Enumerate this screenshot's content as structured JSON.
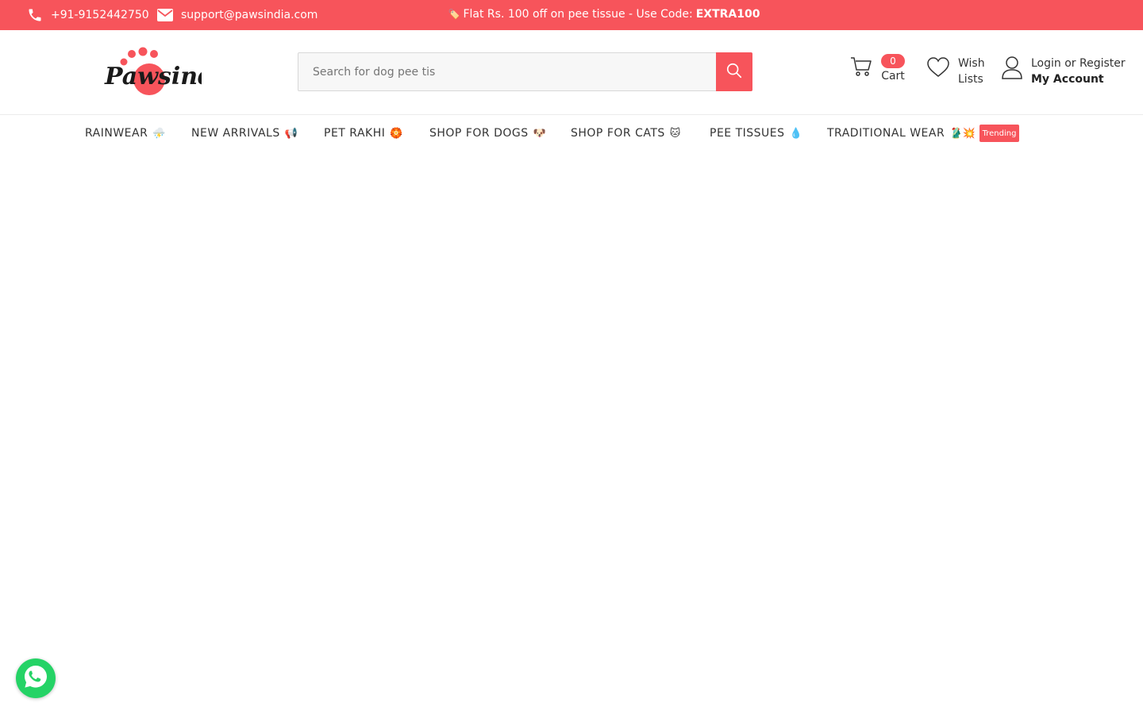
{
  "topbar": {
    "phone": "+91-9152442750",
    "email": "support@pawsindia.com",
    "promo_icon": "🏷️",
    "promo_text": "Flat Rs. 100 off on pee tissue - Use Code:",
    "promo_code": "EXTRA100",
    "bg_color": "#f7545b"
  },
  "header": {
    "logo_text": "Pawsindia",
    "search": {
      "value": "Search for dog pee tis",
      "placeholder": "Search for dog pee tis"
    },
    "cart": {
      "count": "0",
      "label": "Cart"
    },
    "wishlist": {
      "line1": "Wish",
      "line2": "Lists"
    },
    "account": {
      "login": "Login",
      "or": "or",
      "register": "Register",
      "my_account": "My Account"
    }
  },
  "nav": {
    "items": [
      {
        "label": "RAINWEAR",
        "emoji": "⛈️"
      },
      {
        "label": "NEW ARRIVALS",
        "emoji": "📢"
      },
      {
        "label": "PET RAKHI",
        "emoji": "🏵️"
      },
      {
        "label": "SHOP FOR DOGS",
        "emoji": "🐶"
      },
      {
        "label": "SHOP FOR CATS",
        "emoji": "🐱"
      },
      {
        "label": "PEE TISSUES",
        "emoji": "💧"
      },
      {
        "label": "TRADITIONAL WEAR",
        "emoji": "🥻💥",
        "badge": "Trending"
      }
    ]
  },
  "icons": {
    "phone": "phone-icon",
    "email": "envelope-icon",
    "search": "search-icon",
    "cart": "cart-icon",
    "wishlist": "heart-icon",
    "account": "user-icon",
    "chat": "whatsapp-icon"
  },
  "colors": {
    "accent": "#f7545b",
    "whatsapp": "#25d366"
  }
}
